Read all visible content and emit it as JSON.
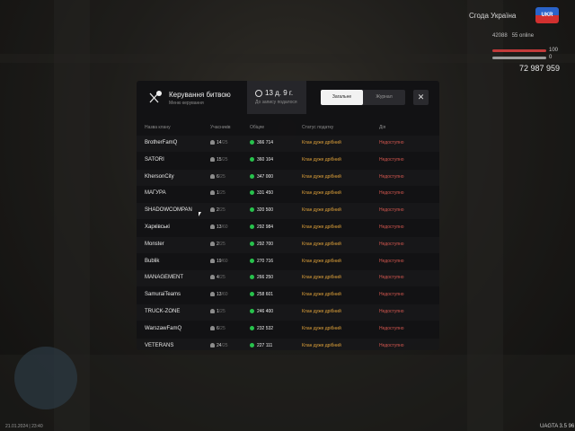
{
  "hud": {
    "server": "Сгода Україна",
    "logo": "UKR",
    "stats": [
      "42088",
      "55 online"
    ],
    "health": "100",
    "armor": "0",
    "money": "72 987 959",
    "version": "UAGTA 3.5",
    "fps": "96",
    "footer_left": "21.01.2024 | 23:40"
  },
  "modal": {
    "title": "Керування битвою",
    "subtitle": "Меню керування",
    "timer": "13 д. 9 г.",
    "timer_sub": "До запису подалося",
    "tabs": [
      {
        "label": "Загальне",
        "active": true
      },
      {
        "label": "Журнал",
        "active": false
      }
    ],
    "close_icon": "close-icon",
    "columns": [
      "Назва клану",
      "Учасників",
      "Обіцяе",
      "Статус податку",
      "Дія"
    ],
    "rows": [
      {
        "name": "BrotherFamQ",
        "members": "14",
        "total": "/25",
        "score": "366 714",
        "status": "Клан дуже дрібний",
        "action": "Недоступно"
      },
      {
        "name": "SATORI",
        "members": "15",
        "total": "/25",
        "score": "360 104",
        "status": "Клан дуже дрібний",
        "action": "Недоступно"
      },
      {
        "name": "KhersonCity",
        "members": "6",
        "total": "/25",
        "score": "347 000",
        "status": "Клан дуже дрібний",
        "action": "Недоступно"
      },
      {
        "name": "МАГУРА",
        "members": "1",
        "total": "/25",
        "score": "331 450",
        "status": "Клан дуже дрібний",
        "action": "Недоступно"
      },
      {
        "name": "SHADOWCOMPAN",
        "members": "2",
        "total": "/25",
        "score": "320 500",
        "status": "Клан дуже дрібний",
        "action": "Недоступно"
      },
      {
        "name": "Харківські",
        "members": "13",
        "total": "/60",
        "score": "292 984",
        "status": "Клан дуже дрібний",
        "action": "Недоступно"
      },
      {
        "name": "Monster",
        "members": "2",
        "total": "/25",
        "score": "292 700",
        "status": "Клан дуже дрібний",
        "action": "Недоступно"
      },
      {
        "name": "Bublik",
        "members": "19",
        "total": "/60",
        "score": "270 716",
        "status": "Клан дуже дрібний",
        "action": "Недоступно"
      },
      {
        "name": "MANAGEMENT",
        "members": "4",
        "total": "/25",
        "score": "266 250",
        "status": "Клан дуже дрібний",
        "action": "Недоступно"
      },
      {
        "name": "SamuraiTeams",
        "members": "13",
        "total": "/60",
        "score": "258 601",
        "status": "Клан дуже дрібний",
        "action": "Недоступно"
      },
      {
        "name": "TRUCK-ZONE",
        "members": "1",
        "total": "/25",
        "score": "246 400",
        "status": "Клан дуже дрібний",
        "action": "Недоступно"
      },
      {
        "name": "WarszawFamQ",
        "members": "6",
        "total": "/25",
        "score": "232 532",
        "status": "Клан дуже дрібний",
        "action": "Недоступно"
      },
      {
        "name": "VETERANS",
        "members": "24",
        "total": "/25",
        "score": "227 111",
        "status": "Клан дуже дрібний",
        "action": "Недоступно"
      }
    ]
  },
  "colors": {
    "status": "#e0a23a",
    "action": "#d4574f",
    "score_dot": "#27c24c"
  }
}
